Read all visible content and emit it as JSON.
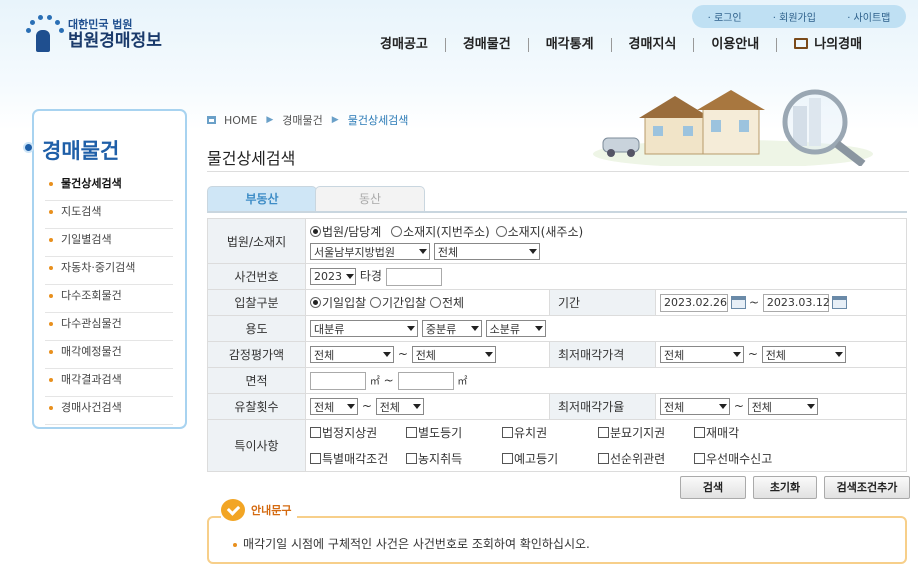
{
  "header": {
    "logo_small": "대한민국 법원",
    "logo_main": "법원경매정보",
    "util_links": [
      "로그인",
      "회원가입",
      "사이트맵"
    ],
    "nav": [
      "경매공고",
      "경매물건",
      "매각통계",
      "경매지식",
      "이용안내",
      "나의경매"
    ]
  },
  "sidebar": {
    "title": "경매물건",
    "items": [
      {
        "label": "물건상세검색",
        "active": true
      },
      {
        "label": "지도검색",
        "active": false
      },
      {
        "label": "기일별검색",
        "active": false
      },
      {
        "label": "자동차·중기검색",
        "active": false
      },
      {
        "label": "다수조회물건",
        "active": false
      },
      {
        "label": "다수관심물건",
        "active": false
      },
      {
        "label": "매각예정물건",
        "active": false
      },
      {
        "label": "매각결과검색",
        "active": false
      },
      {
        "label": "경매사건검색",
        "active": false
      }
    ]
  },
  "breadcrumb": [
    "HOME",
    "경매물건",
    "물건상세검색"
  ],
  "page_title": "물건상세검색",
  "tabs": [
    {
      "label": "부동산",
      "active": true
    },
    {
      "label": "동산",
      "active": false
    }
  ],
  "form": {
    "court": {
      "label": "법원/소재지",
      "radios": [
        {
          "label": "법원/담당계",
          "checked": true
        },
        {
          "label": "소재지(지번주소)",
          "checked": false
        },
        {
          "label": "소재지(새주소)",
          "checked": false
        }
      ],
      "court_select": "서울남부지방법원",
      "dept_select": "전체"
    },
    "case_no": {
      "label": "사건번호",
      "year": "2023",
      "mid": "타경",
      "number": ""
    },
    "bid_type": {
      "label": "입찰구분",
      "radios": [
        {
          "label": "기일입찰",
          "checked": true
        },
        {
          "label": "기간입찰",
          "checked": false
        },
        {
          "label": "전체",
          "checked": false
        }
      ]
    },
    "period": {
      "label": "기간",
      "from": "2023.02.26",
      "to": "2023.03.12",
      "tilde": "~"
    },
    "usage": {
      "label": "용도",
      "big": "대분류",
      "mid": "중분류",
      "small": "소분류"
    },
    "appraisal": {
      "label": "감정평가액",
      "from": "전체",
      "to": "전체"
    },
    "min_price": {
      "label": "최저매각가격",
      "from": "전체",
      "to": "전체"
    },
    "area": {
      "label": "면적",
      "unit": "㎡",
      "from": "",
      "to": ""
    },
    "fail_count": {
      "label": "유찰횟수",
      "from": "전체",
      "to": "전체"
    },
    "min_rate": {
      "label": "최저매각가율",
      "from": "전체",
      "to": "전체"
    },
    "special": {
      "label": "특이사항",
      "row1": [
        "법정지상권",
        "별도등기",
        "유치권",
        "분묘기지권",
        "재매각"
      ],
      "row2": [
        "특별매각조건",
        "농지취득",
        "예고등기",
        "선순위관련",
        "우선매수신고"
      ]
    }
  },
  "buttons": {
    "search": "검색",
    "reset": "초기화",
    "add": "검색조건추가"
  },
  "notice": {
    "title": "안내문구",
    "text": "매각기일 시점에 구체적인 사건은 사건번호로 조회하여 확인하십시오."
  }
}
